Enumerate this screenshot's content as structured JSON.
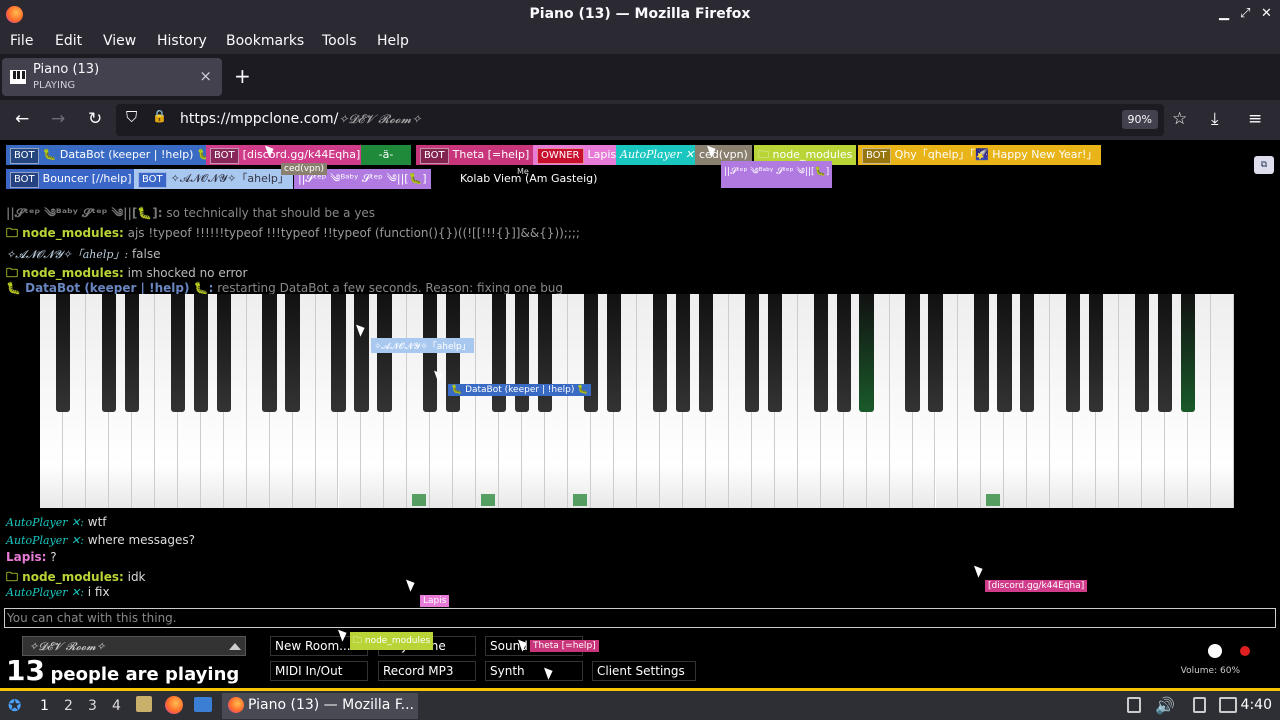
{
  "window": {
    "title": "Piano (13) — Mozilla Firefox",
    "minimize": "▁",
    "maximize": "⤢",
    "close": "✕"
  },
  "menu": [
    "File",
    "Edit",
    "View",
    "History",
    "Bookmarks",
    "Tools",
    "Help"
  ],
  "tab": {
    "title": "Piano (13)",
    "subtitle": "PLAYING",
    "close": "×",
    "new": "+"
  },
  "nav": {
    "back": "←",
    "forward": "→",
    "reload": "↻",
    "shield": "⛉",
    "lock": "🔒",
    "url_host": "https://mppclone.com/",
    "url_room": "✧𝓓𝓔𝓥 𝓡𝓸𝓸𝓶✧",
    "zoom": "90%",
    "star": "☆",
    "download": "⤓",
    "menu": "≡"
  },
  "users": [
    {
      "badge": "BOT",
      "name": "🐛 DataBot (keeper | !help) 🐛",
      "color": "#3a6bc4"
    },
    {
      "badge": "BOT",
      "name": "[discord.gg/k44Eqha]",
      "color": "#d03c8a"
    },
    {
      "badge": "",
      "name": "-ä-",
      "color": "#1e8a3a"
    },
    {
      "badge": "BOT",
      "name": "Theta [=help]",
      "color": "#c8357a"
    },
    {
      "badge": "OWNER",
      "name": "Lapis",
      "color": "#e77bd7"
    },
    {
      "badge": "",
      "name": "AutoPlayer ✕",
      "color": "#1ac7c0"
    },
    {
      "badge": "",
      "name": "ced(vpn)",
      "color": "#8a8070"
    },
    {
      "badge": "",
      "name": "🗀 node_modules",
      "color": "#b9d436"
    },
    {
      "badge": "BOT",
      "name": "Qhy「qhelp」「🌠 Happy New Year!」",
      "color": "#e8b418"
    },
    {
      "badge": "BOT",
      "name": "Bouncer [//help]",
      "color": "#3a66c8"
    },
    {
      "badge": "BOT",
      "name": "✧𝓐𝓝𝓞𝓝𝓨✧「ahelp」",
      "color": "#a9c8f0"
    },
    {
      "badge": "",
      "name": "||𝓢ᵗᵉᵖ ༄ᴮᵃᵇʸ 𝓢ᵗᵉᵖ ༄||[🐛]",
      "color": "#b07ae0"
    },
    {
      "badge": "",
      "name": "Kolab Viem (Am Gasteig)",
      "color": "#000000"
    }
  ],
  "chat_top": [
    {
      "name": "||𝓢ᵗᵉᵖ ༄ᴮᵃᵇʸ 𝓢ᵗᵉᵖ ༄||[🐛]:",
      "text": "so technically that should be a yes",
      "color": "#777777"
    },
    {
      "name": "🗀 node_modules:",
      "text": "ajs !typeof !!!!!!typeof !!!typeof !!typeof (function(){})((![[!!!{}]]&&{}));;;;",
      "color": "#b9d436"
    },
    {
      "name": "✧𝓐𝓝𝓞𝓝𝓨✧「ahelp」:",
      "text": "false",
      "color": "#a9c8f0"
    },
    {
      "name": "🗀 node_modules:",
      "text": "im shocked no error",
      "color": "#b9d436"
    },
    {
      "name": "🐛 DataBot (keeper | !help) 🐛:",
      "text": "restarting DataBot a few seconds. Reason: fixing one bug",
      "color": "#3a6bc4"
    }
  ],
  "chat_bottom": [
    {
      "name": "AutoPlayer ✕:",
      "text": "wtf",
      "color": "#1ac7c0"
    },
    {
      "name": "AutoPlayer ✕:",
      "text": "where messages?",
      "color": "#1ac7c0"
    },
    {
      "name": "Lapis:",
      "text": "?",
      "color": "#e77bd7"
    },
    {
      "name": "🗀 node_modules:",
      "text": "idk",
      "color": "#b9d436"
    },
    {
      "name": "AutoPlayer ✕:",
      "text": "i fix",
      "color": "#1ac7c0"
    }
  ],
  "cursor_tags": {
    "ced": "ced(vpn)",
    "me": "Me",
    "anon": "✧𝓐𝓝𝓞𝓝𝓨✧「ahelp」",
    "databot": "🐛 DataBot (keeper | !help) 🐛",
    "discord": "[discord.gg/k44Eqha]",
    "lapis": "Lapis",
    "node": "🗀 node_modules",
    "theta": "Theta [=help]",
    "step": "||𝓢ᵗᵉᵖ ༄ᴮᵃᵇʸ 𝓢ᵗᵉᵖ ༄||[🐛]"
  },
  "chat_input_placeholder": "You can chat with this thing.",
  "room_select": "✧𝓓𝓔𝓥 𝓡𝓸𝓸𝓶✧",
  "player_count": {
    "number": "13",
    "label": "people are playing"
  },
  "buttons": {
    "new_room": "New Room...",
    "play_alone": "Play Alone",
    "sound": "Sound Selector",
    "midi": "MIDI In/Out",
    "record": "Record MP3",
    "synth": "Synth",
    "client_settings": "Client Settings"
  },
  "volume": "Volume: 60%",
  "taskbar": {
    "workspaces": [
      "1",
      "2",
      "3",
      "4"
    ],
    "app": "Piano (13) — Mozilla F...",
    "clock": "4:40"
  }
}
